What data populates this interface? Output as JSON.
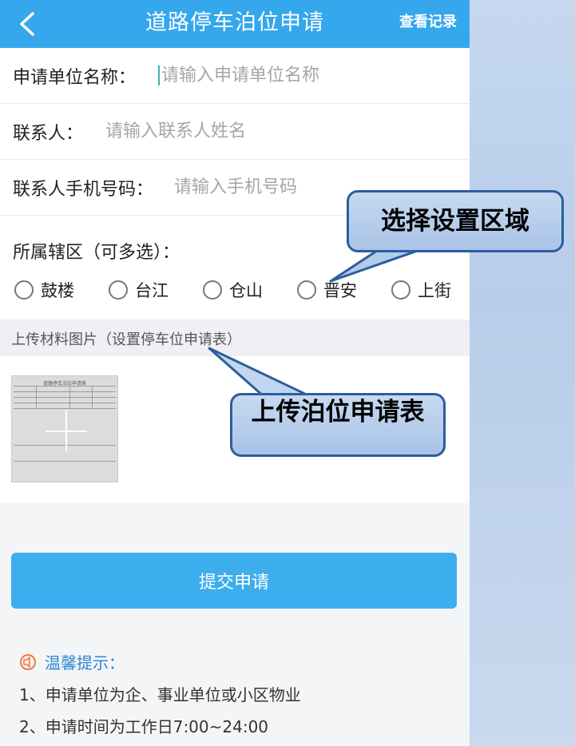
{
  "header": {
    "title": "道路停车泊位申请",
    "record_link": "查看记录"
  },
  "form": {
    "unit_name": {
      "label": "申请单位名称：",
      "placeholder": "请输入申请单位名称",
      "value": ""
    },
    "contact": {
      "label": "联系人：",
      "placeholder": "请输入联系人姓名",
      "value": ""
    },
    "phone": {
      "label": "联系人手机号码：",
      "placeholder": "请输入手机号码",
      "value": ""
    },
    "district": {
      "label": "所属辖区（可多选）：",
      "options": [
        "鼓楼",
        "台江",
        "仓山",
        "晋安",
        "上街"
      ]
    }
  },
  "upload": {
    "label": "上传材料图片（设置停车位申请表）"
  },
  "submit_label": "提交申请",
  "tips": {
    "title": "温馨提示：",
    "items": [
      "1、申请单位为企、事业单位或小区物业",
      "2、申请时间为工作日7:00~24:00"
    ]
  },
  "annotations": {
    "district_callout": "选择设置区域",
    "upload_callout": "上传泊位申请表"
  },
  "colors": {
    "header": "#35a7ec",
    "submit": "#3caeee",
    "tips_title": "#2f86d6",
    "callout_border": "#2c5d9e"
  },
  "icons": {
    "back": "chevron-left-icon",
    "tip": "tip-icon",
    "upload_plus": "plus-icon"
  }
}
